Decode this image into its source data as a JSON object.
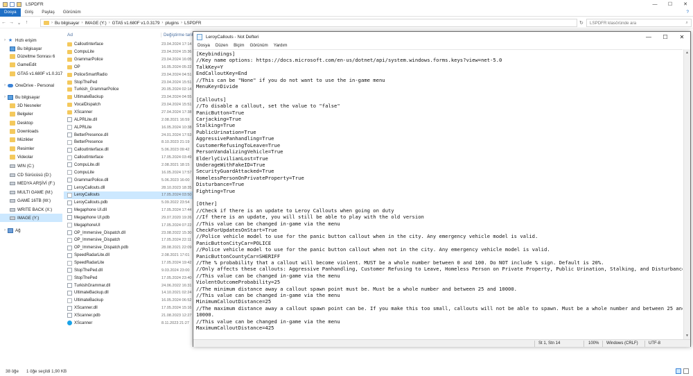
{
  "explorer": {
    "title": "LSPDFR",
    "window_controls": [
      "—",
      "☐",
      "✕"
    ],
    "ribbon_tabs": [
      "Dosya",
      "Giriş",
      "Paylaş",
      "Görünüm"
    ],
    "breadcrumb": [
      "Bu bilgisayar",
      "IMAGE (Y:)",
      "GTA5 v1.680F v1.0.3179",
      "plugins",
      "LSPDFR"
    ],
    "search_placeholder": "LSPDFR klasöründe ara",
    "sidebar": [
      {
        "label": "Hızlı erişim",
        "icon": "star-icon",
        "indent": 0
      },
      {
        "label": "Bu bilgisayar",
        "icon": "pc-icon",
        "indent": 1
      },
      {
        "label": "Düzeltme Sonrası 6",
        "icon": "folder-icon",
        "indent": 1
      },
      {
        "label": "GameEdit",
        "icon": "folder-icon",
        "indent": 1
      },
      {
        "label": "GTA5 v1.680F v1.0.317",
        "icon": "folder-icon",
        "indent": 1
      },
      {
        "label": "OneDrive - Personal",
        "icon": "cloud-icon",
        "indent": 0
      },
      {
        "label": "Bu bilgisayar",
        "icon": "pc-icon",
        "indent": 0
      },
      {
        "label": "3D Nesneler",
        "icon": "folder-icon",
        "indent": 1
      },
      {
        "label": "Belgeler",
        "icon": "folder-icon",
        "indent": 1
      },
      {
        "label": "Desktop",
        "icon": "folder-icon",
        "indent": 1
      },
      {
        "label": "Downloads",
        "icon": "folder-icon",
        "indent": 1
      },
      {
        "label": "Müzikler",
        "icon": "folder-icon",
        "indent": 1
      },
      {
        "label": "Resimler",
        "icon": "folder-icon",
        "indent": 1
      },
      {
        "label": "Videolar",
        "icon": "folder-icon",
        "indent": 1
      },
      {
        "label": "WIN (C:)",
        "icon": "drive-icon",
        "indent": 1
      },
      {
        "label": "CD Sürücüsü (D:)",
        "icon": "drive-icon",
        "indent": 1
      },
      {
        "label": "MEDYA ARŞİVİ (F:)",
        "icon": "drive-icon",
        "indent": 1
      },
      {
        "label": "MULTI GAME (M:)",
        "icon": "drive-icon",
        "indent": 1
      },
      {
        "label": "GAME 16TB (W:)",
        "icon": "drive-icon",
        "indent": 1
      },
      {
        "label": "WRITE BACK (X:)",
        "icon": "drive-icon",
        "indent": 1
      },
      {
        "label": "IMAGE (Y:)",
        "icon": "drive-icon",
        "indent": 1,
        "selected": true
      },
      {
        "label": "Ağ",
        "icon": "network-icon",
        "indent": 0
      }
    ],
    "columns": {
      "name": "Ad",
      "date": "Değiştirme tarihi"
    },
    "files": [
      {
        "name": "CalloutInterface",
        "date": "23.04.2024 17:14",
        "type": "folder"
      },
      {
        "name": "CompuLite",
        "date": "23.04.2024 15:36",
        "type": "folder"
      },
      {
        "name": "GrammarPolice",
        "date": "23.04.2024 16:05",
        "type": "folder"
      },
      {
        "name": "OP",
        "date": "16.05.2024 05:22",
        "type": "folder"
      },
      {
        "name": "PoliceSmartRadio",
        "date": "23.04.2024 04:51",
        "type": "folder"
      },
      {
        "name": "StopThePed",
        "date": "23.04.2024 15:51",
        "type": "folder"
      },
      {
        "name": "Turkish_GrammarPolice",
        "date": "20.05.2024 02:14",
        "type": "folder"
      },
      {
        "name": "UltimateBackup",
        "date": "23.04.2024 04:55",
        "type": "folder"
      },
      {
        "name": "VocalDispatch",
        "date": "23.04.2024 15:51",
        "type": "folder"
      },
      {
        "name": "XScanner",
        "date": "27.04.2024 17:38",
        "type": "folder"
      },
      {
        "name": "ALPRLite.dll",
        "date": "2.08.2021 16:59",
        "type": "dll"
      },
      {
        "name": "ALPRLite",
        "date": "16.05.2024 10:38",
        "type": "file"
      },
      {
        "name": "BetterPresence.dll",
        "date": "24.01.2024 17:53",
        "type": "dll"
      },
      {
        "name": "BetterPresence",
        "date": "8.10.2023 21:19",
        "type": "file"
      },
      {
        "name": "CalloutInterface.dll",
        "date": "5.06.2023 09:42",
        "type": "dll"
      },
      {
        "name": "CalloutInterface",
        "date": "17.05.2024 03:49",
        "type": "file"
      },
      {
        "name": "CompuLite.dll",
        "date": "2.08.2021 18:15",
        "type": "dll"
      },
      {
        "name": "CompuLite",
        "date": "16.05.2024 17:57",
        "type": "file"
      },
      {
        "name": "GrammarPolice.dll",
        "date": "5.06.2023 16:00",
        "type": "dll"
      },
      {
        "name": "LeroyCallouts.dll",
        "date": "28.10.2023 18:35",
        "type": "dll"
      },
      {
        "name": "LeroyCallouts",
        "date": "17.05.2024 03:50",
        "type": "file",
        "selected": true
      },
      {
        "name": "LeroyCallouts.pdb",
        "date": "5.09.2022 23:54",
        "type": "pdb"
      },
      {
        "name": "Megaphone UI.dll",
        "date": "17.05.2024 17:44",
        "type": "dll"
      },
      {
        "name": "Megaphone UI.pdb",
        "date": "29.07.2020 19:26",
        "type": "pdb"
      },
      {
        "name": "MegaphoneUI",
        "date": "17.05.2024 07:22",
        "type": "file"
      },
      {
        "name": "OP_Immersive_Dispatch.dll",
        "date": "23.08.2022 15:30",
        "type": "dll"
      },
      {
        "name": "OP_Immersive_Dispatch",
        "date": "17.05.2024 22:11",
        "type": "file"
      },
      {
        "name": "OP_Immersive_Dispatch.pdb",
        "date": "28.08.2021 22:09",
        "type": "pdb"
      },
      {
        "name": "SpeedRadarLite.dll",
        "date": "2.08.2021 17:01",
        "type": "dll"
      },
      {
        "name": "SpeedRadarLite",
        "date": "17.05.2024 19:42",
        "type": "file"
      },
      {
        "name": "StopThePed.dll",
        "date": "9.03.2024 23:00",
        "type": "dll"
      },
      {
        "name": "StopThePed",
        "date": "17.05.2024 23:40",
        "type": "file"
      },
      {
        "name": "TurkishGrammar.dll",
        "date": "24.06.2022 16:31",
        "type": "dll"
      },
      {
        "name": "UltimateBackup.dll",
        "date": "14.10.2021 02:24",
        "type": "dll"
      },
      {
        "name": "UltimateBackup",
        "date": "16.05.2024 06:52",
        "type": "file"
      },
      {
        "name": "XScanner.dll",
        "date": "17.05.2024 15:16",
        "type": "dll"
      },
      {
        "name": "XScanner.pdb",
        "date": "21.08.2023 12:27",
        "type": "pdb"
      },
      {
        "name": "XScanner",
        "date": "8.11.2023 21:27",
        "type": "exe"
      }
    ],
    "status": {
      "count": "38 öğe",
      "selection": "1 öğe seçildi  1,90 KB"
    }
  },
  "notepad": {
    "title": "LeroyCallouts - Not Defteri",
    "window_controls": [
      "—",
      "☐",
      "✕"
    ],
    "menu": [
      "Dosya",
      "Düzen",
      "Biçim",
      "Görünüm",
      "Yardım"
    ],
    "content": "[Keybindings]\n//Key name options: https://docs.microsoft.com/en-us/dotnet/api/system.windows.forms.keys?view=net-5.0\nTalkKey=Y\nEndCalloutKey=End\n//This can be \"None\" if you do not want to use the in-game menu\nMenuKey=Divide\n\n[Callouts]\n//To disable a callout, set the value to \"false\"\nPanicButton=True\nCarjacking=True\nStalking=True\nPublicUrination=True\nAggressivePanhandling=True\nCustomerRefusingToLeave=True\nPersonVandalizingVehicle=True\nElderlyCivilianLost=True\nUnderageWithFakeID=True\nSecurityGuardAttacked=True\nHomelessPersonOnPrivateProperty=True\nDisturbance=True\nFighting=True\n\n[Other]\n//Check if there is an update to Leroy Callouts when going on duty\n//If there is an update, you will still be able to play with the old version\n//This value can be changed in-game via the menu\nCheckForUpdatesOnStart=True\n//Police vehicle model to use for the panic button callout when in the city. Any emergency vehicle model is valid.\nPanicButtonCityCar=POLICE\n//Police vehicle model to use for the panic button callout when not in the city. Any emergency vehicle model is valid.\nPanicButtonCountyCar=SHERIFF\n//The % probability that a callout will become violent. MUST be a whole number between 0 and 100. Do NOT include % sign. Default is 20%.\n//Only affects these callouts: Aggressive Panhandling, Customer Refusing to Leave, Homeless Person on Private Property, Public Urination, Stalking, and Disturbance.\n//This value can be changed in-game via the menu\nViolentOutcomeProbability=25\n//The minimum distance away a callout spawn point must be. Must be a whole number and between 25 and 10000.\n//This value can be changed in-game via the menu\nMinimumCalloutDistance=25\n//The maximum distance away a callout spawn point can be. If you make this too small, callouts will not be able to spawn. Must be a whole number and between 25 and\n10000.\n//This value can be changed in-game via the menu\nMaximumCalloutDistance=425",
    "status": {
      "position": "St 1, Stn 14",
      "zoom": "100%",
      "line_ending": "Windows (CRLF)",
      "encoding": "UTF-8"
    }
  }
}
